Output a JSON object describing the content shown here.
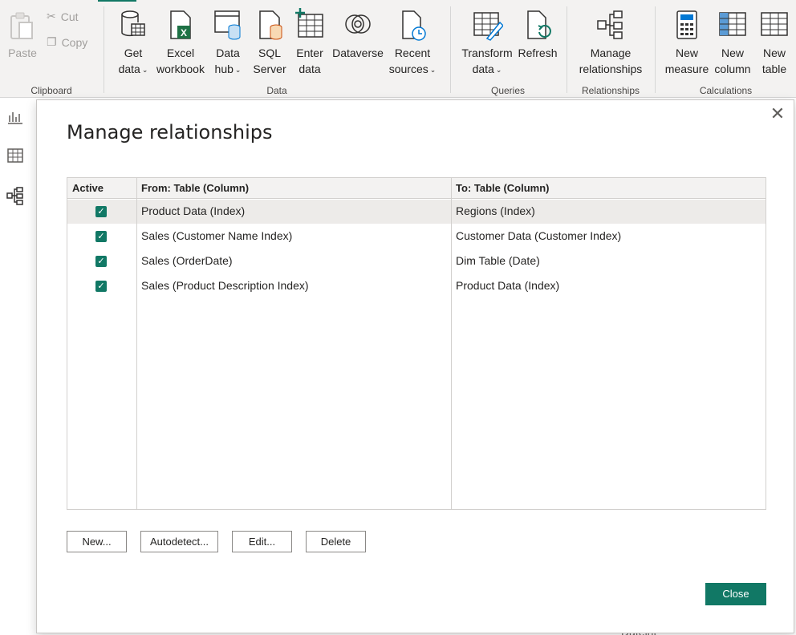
{
  "ribbon": {
    "clipboard": {
      "paste": "Paste",
      "cut": "Cut",
      "copy": "Copy",
      "group_label": "Clipboard"
    },
    "data": {
      "get_data": [
        "Get",
        "data"
      ],
      "excel": [
        "Excel",
        "workbook"
      ],
      "data_hub": [
        "Data",
        "hub"
      ],
      "sql_server": [
        "SQL",
        "Server"
      ],
      "enter_data": [
        "Enter",
        "data"
      ],
      "dataverse": "Dataverse",
      "recent_sources": [
        "Recent",
        "sources"
      ],
      "group_label": "Data"
    },
    "queries": {
      "transform": [
        "Transform",
        "data"
      ],
      "refresh": "Refresh",
      "group_label": "Queries"
    },
    "relationships": {
      "manage": [
        "Manage",
        "relationships"
      ],
      "group_label": "Relationships"
    },
    "calculations": {
      "new_measure": [
        "New",
        "measure"
      ],
      "new_column": [
        "New",
        "column"
      ],
      "new_table": [
        "New",
        "table"
      ],
      "group_label": "Calculations"
    }
  },
  "dialog": {
    "title": "Manage relationships",
    "columns": {
      "active": "Active",
      "from": "From: Table (Column)",
      "to": "To: Table (Column)"
    },
    "rows": [
      {
        "active": true,
        "from": "Product Data (Index)",
        "to": "Regions (Index)",
        "selected": true
      },
      {
        "active": true,
        "from": "Sales (Customer Name Index)",
        "to": "Customer Data (Customer Index)",
        "selected": false
      },
      {
        "active": true,
        "from": "Sales (OrderDate)",
        "to": "Dim Table (Date)",
        "selected": false
      },
      {
        "active": true,
        "from": "Sales (Product Description Index)",
        "to": "Product Data (Index)",
        "selected": false
      }
    ],
    "buttons": {
      "new": "New...",
      "autodetect": "Autodetect...",
      "edit": "Edit...",
      "delete": "Delete",
      "close": "Close"
    }
  },
  "background_text": "Dateint",
  "colors": {
    "accent": "#117865",
    "ribbon_bg": "#f3f2f1",
    "selected_row": "#edebe9"
  }
}
